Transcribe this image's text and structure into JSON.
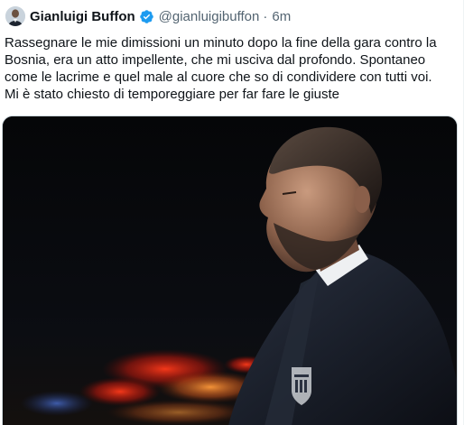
{
  "tweet": {
    "author_name": "Gianluigi Buffon",
    "handle": "@gianluigibuffon",
    "separator": "·",
    "time": "6m",
    "text": "Rassegnare le mie dimissioni un minuto dopo la fine della gara contro la Bosnia, era un atto impellente, che mi usciva dal profondo. Spontaneo come le lacrime e quel male al cuore che so di condividere con tutti voi.\nMi è stato chiesto di temporeggiare per far fare le giuste"
  },
  "icons": {
    "avatar": "profile-photo",
    "verified": "verified-badge-icon"
  },
  "colors": {
    "verified_blue": "#1d9bf0",
    "text_primary": "#0f1419",
    "text_secondary": "#536471"
  }
}
